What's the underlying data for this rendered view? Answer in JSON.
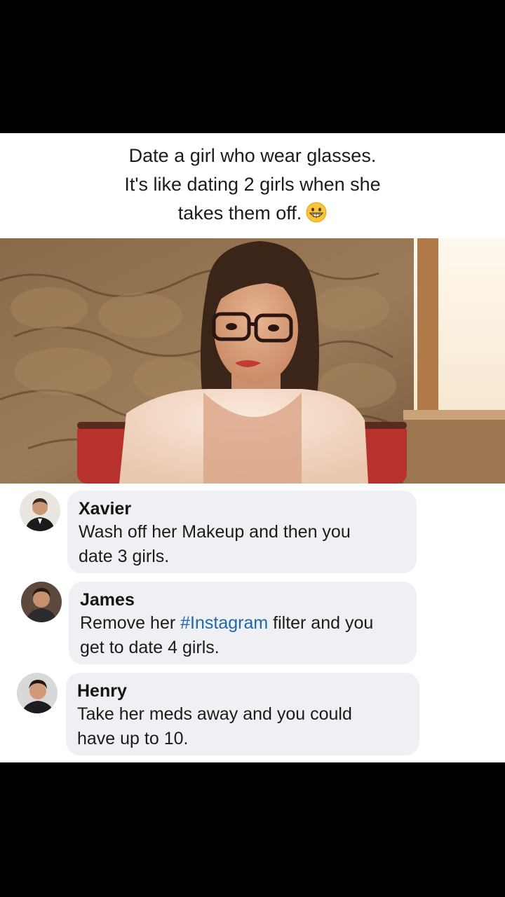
{
  "post": {
    "caption_line1": "Date a girl who wear glasses.",
    "caption_line2": "It's like dating 2 girls when she",
    "caption_line3": "takes them off.",
    "caption_emoji": "grinning-face-emoji"
  },
  "photo": {
    "subject": "woman-with-glasses-photo"
  },
  "comments": [
    {
      "author": "Xavier",
      "text_line1": "Wash off her Makeup and then you",
      "text_line2": "date 3 girls."
    },
    {
      "author": "James",
      "text_before": "Remove her ",
      "hashtag": "#Instagram",
      "text_after": " filter and you",
      "text_line2": "get to date 4 girls."
    },
    {
      "author": "Henry",
      "text_line1": "Take her meds away and you could",
      "text_line2": "have up to 10."
    }
  ],
  "colors": {
    "background": "#000000",
    "card": "#ffffff",
    "bubble": "#eef0f3",
    "hashtag": "#2267a8"
  }
}
